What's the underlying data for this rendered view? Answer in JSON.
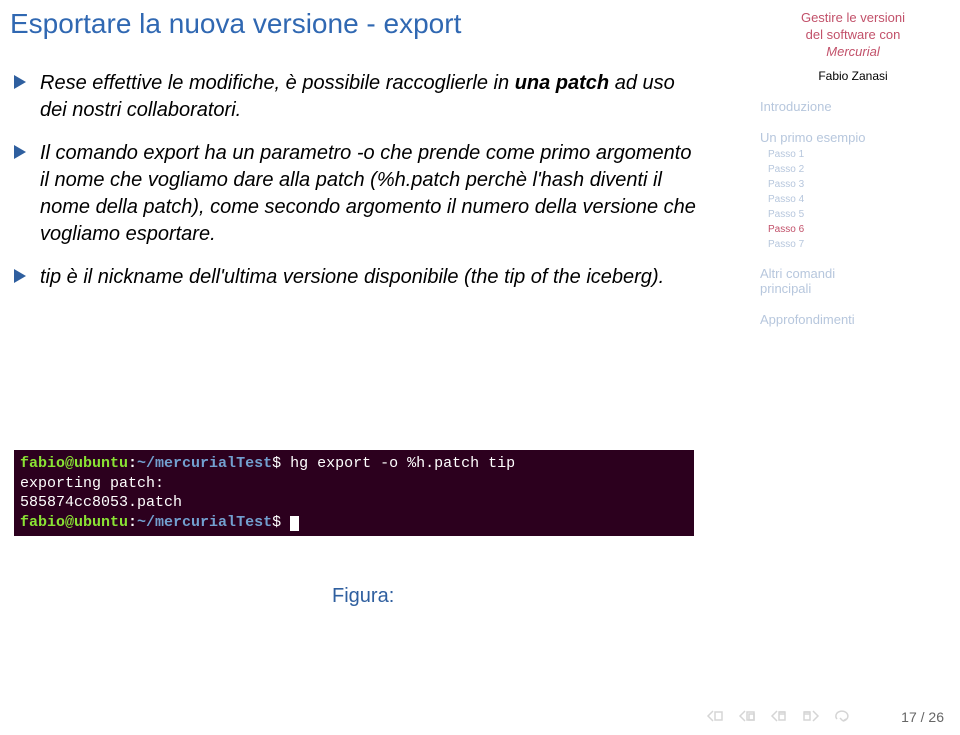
{
  "title": "Esportare la nuova versione - export",
  "bullets": [
    {
      "html": "Rese effettive le modifiche, è possibile raccoglierle in <b>una patch</b> ad uso dei nostri collaboratori."
    },
    {
      "html": "Il comando <span style='font-style:italic'>export</span> ha un parametro -o che prende come primo argomento il nome che vogliamo dare alla patch (%h.patch perchè l'hash diventi il nome della patch), come secondo argomento il numero della versione che vogliamo esportare."
    },
    {
      "html": "<span style='font-style:italic'>tip</span> è il nickname dell'ultima versione disponibile (<span style='font-style:italic'>the tip of the iceberg</span>)."
    }
  ],
  "terminal": {
    "user": "fabio@ubuntu",
    "path": "~/mercurialTest",
    "cmd": "hg export -o %h.patch tip",
    "l2": "exporting patch:",
    "l3": "585874cc8053.patch"
  },
  "figure_label": "Figura:",
  "sidebar": {
    "title_l1": "Gestire le versioni",
    "title_l2": "del software con",
    "title_l3": "Mercurial",
    "author": "Fabio Zanasi",
    "s1": "Introduzione",
    "s2": "Un primo esempio",
    "steps": [
      "Passo 1",
      "Passo 2",
      "Passo 3",
      "Passo 4",
      "Passo 5",
      "Passo 6",
      "Passo 7"
    ],
    "current_step_index": 5,
    "s3_l1": "Altri comandi",
    "s3_l2": "principali",
    "s4": "Approfondimenti"
  },
  "page": "17 / 26"
}
